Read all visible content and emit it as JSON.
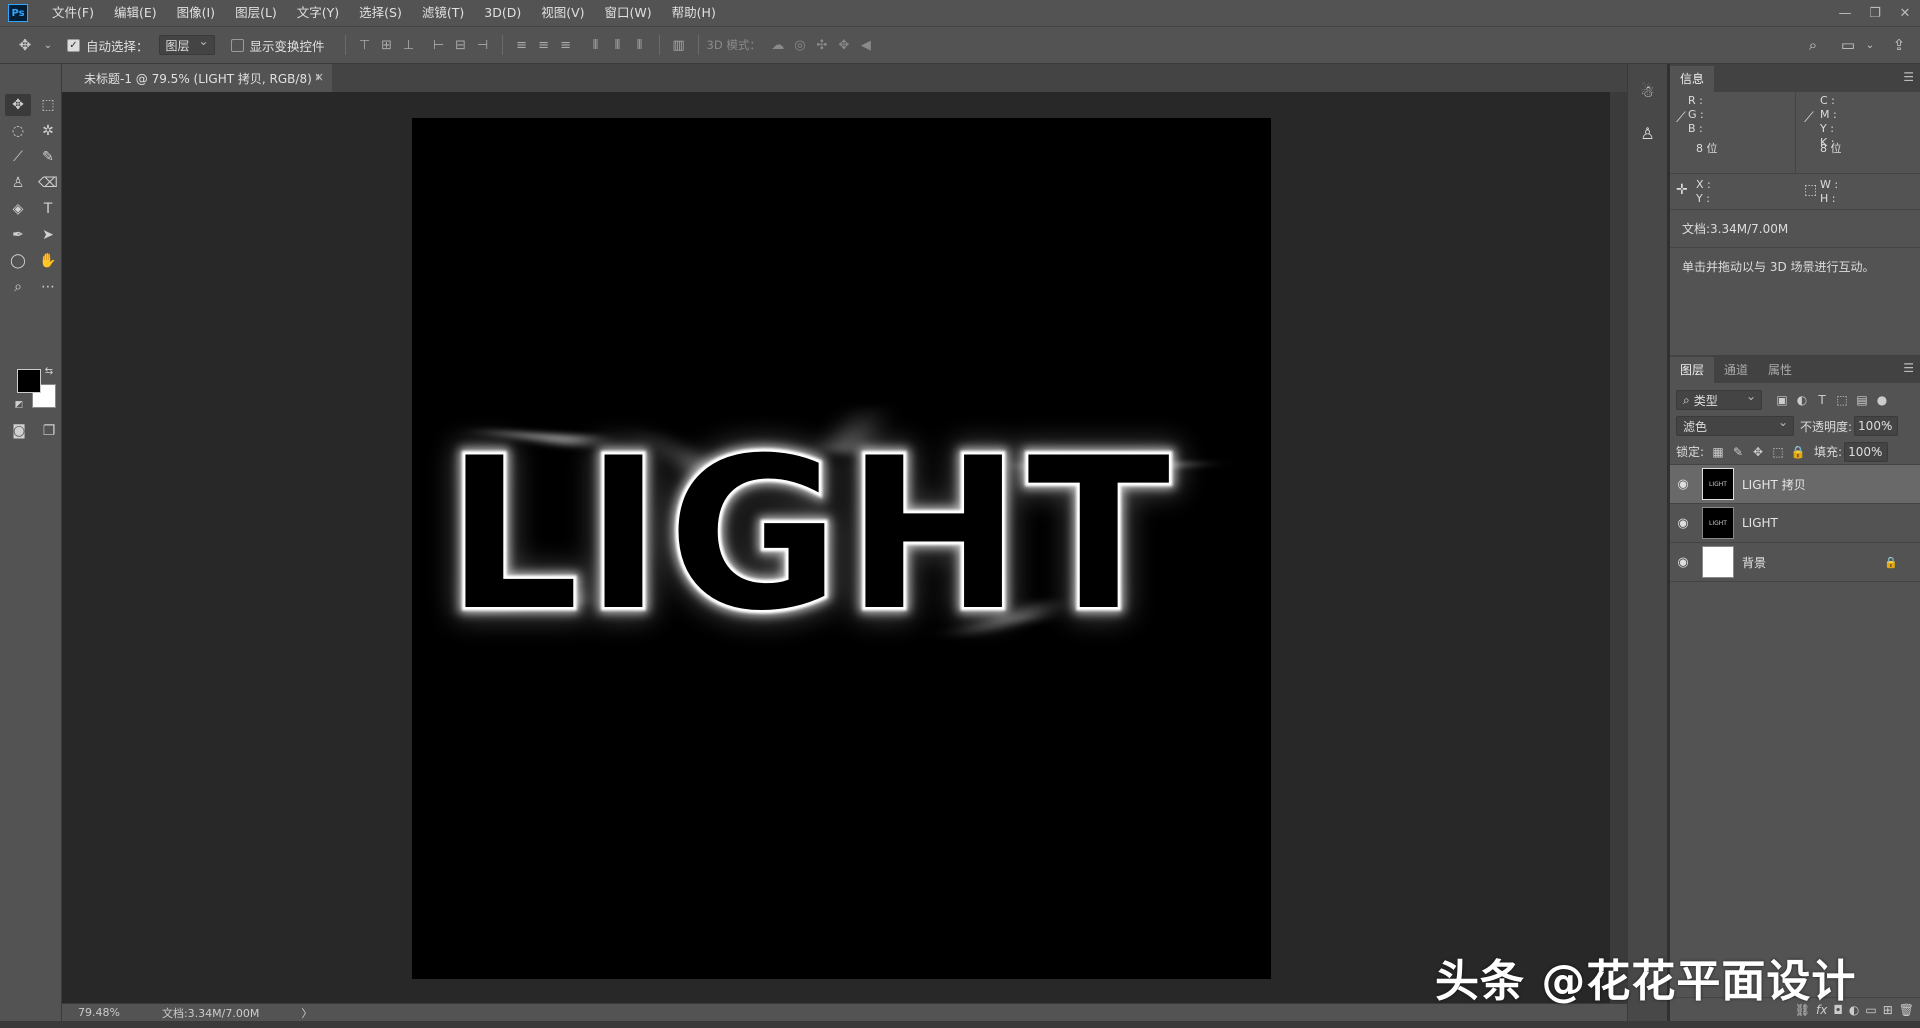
{
  "app": {
    "logo": "Ps"
  },
  "menu": [
    "文件(F)",
    "编辑(E)",
    "图像(I)",
    "图层(L)",
    "文字(Y)",
    "选择(S)",
    "滤镜(T)",
    "3D(D)",
    "视图(V)",
    "窗口(W)",
    "帮助(H)"
  ],
  "options": {
    "auto_select_label": "自动选择：",
    "auto_select_value": "图层",
    "show_transform_label": "显示变换控件",
    "mode_3d_label": "3D 模式："
  },
  "document": {
    "tab_title": "未标题-1 @ 79.5% (LIGHT 拷贝, RGB/8) *",
    "close_glyph": "×",
    "canvas_text": "LIGHT"
  },
  "status": {
    "zoom": "79.48%",
    "doc_info": "文档:3.34M/7.00M",
    "arrow": "〉"
  },
  "info_panel": {
    "tab": "信息",
    "rgb_labels": [
      "R :",
      "G :",
      "B :"
    ],
    "cmyk_labels": [
      "C :",
      "M :",
      "Y :",
      "K :"
    ],
    "bit_left": "8 位",
    "bit_right": "8 位",
    "xy_labels": [
      "X :",
      "Y :"
    ],
    "wh_labels": [
      "W :",
      "H :"
    ],
    "doc_size": "文档:3.34M/7.00M",
    "hint": "单击并拖动以与 3D 场景进行互动。"
  },
  "layers_panel": {
    "tabs": [
      "图层",
      "通道",
      "属性"
    ],
    "filter_label": "类型",
    "blend_mode": "滤色",
    "opacity_label": "不透明度:",
    "opacity_value": "100%",
    "lock_label": "锁定:",
    "fill_label": "填充:",
    "fill_value": "100%",
    "layers": [
      {
        "name": "LIGHT 拷贝",
        "selected": true,
        "thumb": "black"
      },
      {
        "name": "LIGHT",
        "selected": false,
        "thumb": "black"
      },
      {
        "name": "背景",
        "selected": false,
        "thumb": "white",
        "locked": true
      }
    ]
  },
  "watermark": "头条 @花花平面设计"
}
